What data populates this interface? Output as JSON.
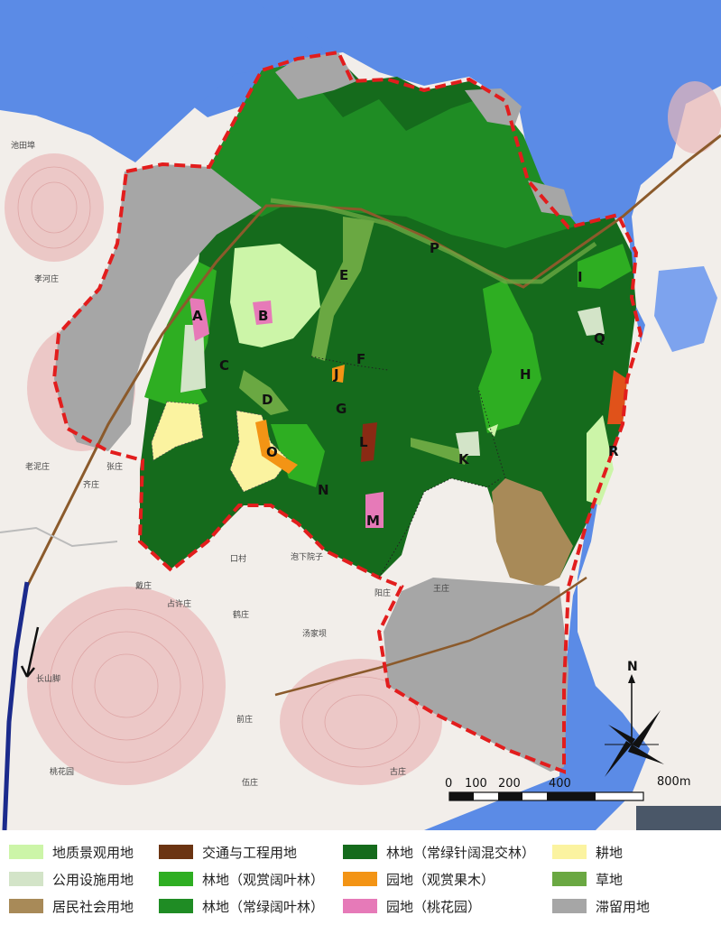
{
  "zone_labels": [
    "A",
    "B",
    "C",
    "D",
    "E",
    "F",
    "G",
    "H",
    "I",
    "J",
    "K",
    "L",
    "M",
    "N",
    "O",
    "P",
    "Q",
    "R"
  ],
  "north_label": "N",
  "scale_labels": [
    "0",
    "100",
    "200",
    "400",
    "800m"
  ],
  "place_names": [
    "池田埠",
    "孝河庄",
    "老泥庄",
    "张庄",
    "齐庄",
    "口村",
    "戴庄",
    "占许庄",
    "泡下院子",
    "汤家坝",
    "阳庄",
    "鹤庄",
    "长山脚",
    "前庄",
    "桃花园",
    "伍庄",
    "王庄",
    "古庄"
  ],
  "legend": [
    {
      "label": "地质景观用地",
      "color": "#ccf5a8"
    },
    {
      "label": "公用设施用地",
      "color": "#d3e4c8"
    },
    {
      "label": "居民社会用地",
      "color": "#a88a58"
    },
    {
      "label": "交通与工程用地",
      "color": "#6b3412"
    },
    {
      "label": "林地（观赏阔叶林）",
      "color": "#2eae22"
    },
    {
      "label": "林地（常绿阔叶林）",
      "color": "#1f8c24"
    },
    {
      "label": "林地（常绿针阔混交林）",
      "color": "#156b1c"
    },
    {
      "label": "园地（观赏果木）",
      "color": "#f39415"
    },
    {
      "label": "园地（桃花园）",
      "color": "#e67ab8"
    },
    {
      "label": "耕地",
      "color": "#fbf3a0"
    },
    {
      "label": "草地",
      "color": "#6aa842"
    },
    {
      "label": "滞留用地",
      "color": "#a6a6a6"
    }
  ],
  "colors": {
    "water": "#5b8be6",
    "boundary": "#e21d1d",
    "road": "#8b5a2b",
    "highway": "#1b2a8c",
    "base_land": "#f2eeea",
    "relief": "#e9b8b8"
  }
}
